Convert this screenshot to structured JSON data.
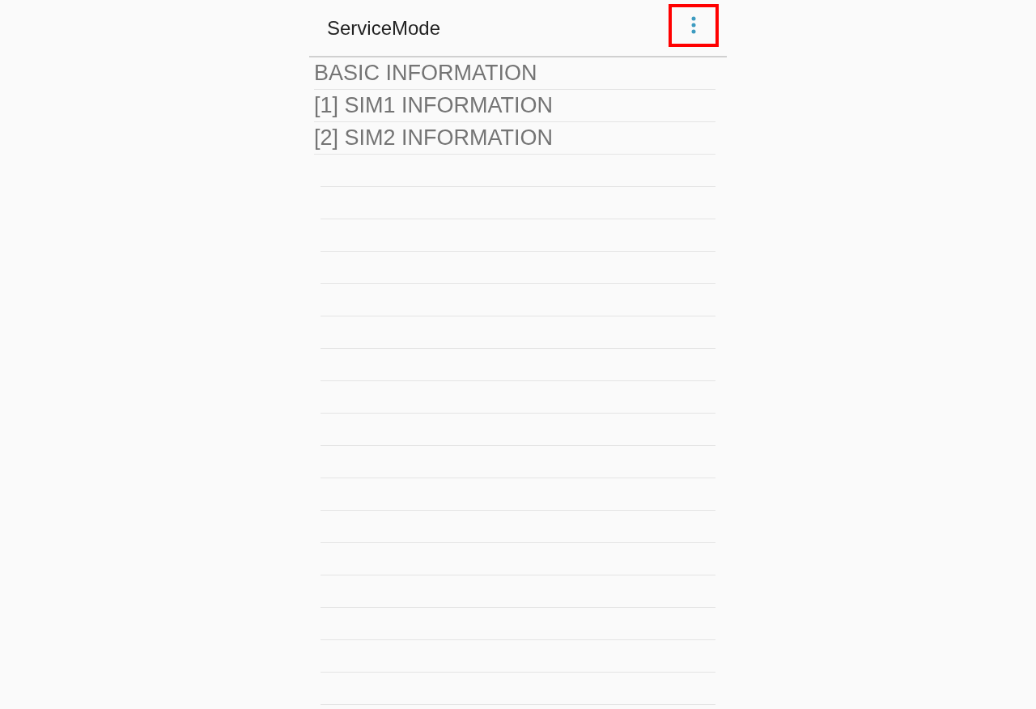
{
  "app_bar": {
    "title": "ServiceMode",
    "menu_button": {
      "highlighted": true
    }
  },
  "menu_items": [
    {
      "label": "BASIC INFORMATION"
    },
    {
      "label": "[1] SIM1 INFORMATION"
    },
    {
      "label": "[2] SIM2 INFORMATION"
    }
  ]
}
